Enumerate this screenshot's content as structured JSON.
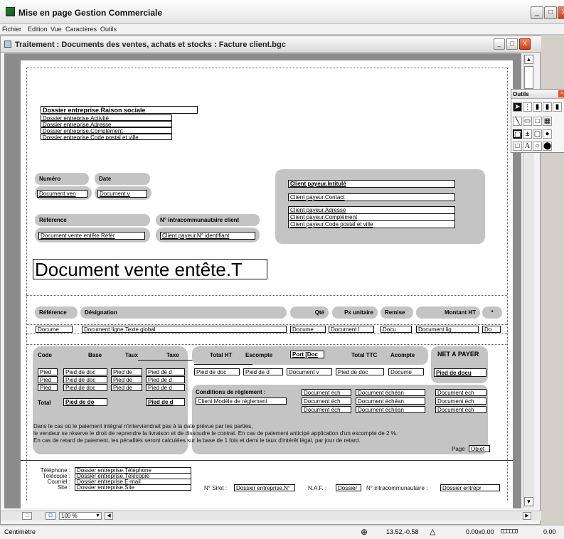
{
  "app": {
    "title": "Mise en page Gestion Commerciale"
  },
  "menu": [
    "Fichier",
    "Edition",
    "Vue",
    "Caractères",
    "Outils"
  ],
  "doc_window": {
    "title": "Traitement : Documents des ventes, achats et stocks : Facture client.bgc"
  },
  "company": {
    "raison": "Dossier entreprise.Raison sociale",
    "activite": "Dossier entreprise.Activité",
    "adresse": "Dossier entreprise.Adresse",
    "complement": "Dossier entreprise.Complément",
    "cp_ville": "Dossier entreprise.Code postal et ville"
  },
  "header": {
    "numero_label": "Numéro",
    "date_label": "Date",
    "numero_field": "Document ven",
    "date_field": "Document v",
    "reference_label": "Référence",
    "intracom_label": "N° intracommunautaire client",
    "reference_field": "Document vente entête.Référ",
    "intracom_field": "Client payeur.N° identifiant"
  },
  "client": {
    "intitule": "Client payeur.Intitulé",
    "contact": "Client payeur.Contact",
    "adresse": "Client payeur.Adresse",
    "complement": "Client payeur.Complément",
    "cp_ville": "Client payeur.Code postal et ville"
  },
  "big_title": "Document vente entête.T",
  "lines_header": {
    "reference": "Référence",
    "designation": "Désignation",
    "qte": "Qté",
    "pu": "Px unitaire",
    "remise": "Remise",
    "montant": "Montant HT",
    "star": "*"
  },
  "lines_row": [
    "Docume",
    "Document ligne.Texte global",
    "Docume",
    "Document l",
    "Docu",
    "Document lig",
    "Do"
  ],
  "totals_header": {
    "code": "Code",
    "base": "Base",
    "taux": "Taux",
    "taxe": "Taxe",
    "total_ht": "Total HT",
    "escompte": "Escompte",
    "port": "Port [Doc",
    "total_ttc": "Total TTC",
    "acompte": "Acompte",
    "net": "NET A PAYER"
  },
  "tax_rows": [
    [
      "Pied",
      "Pied de doc",
      "Pied de",
      "Pied de d"
    ],
    [
      "Pied",
      "Pied de doc",
      "Pied de",
      "Pied de d"
    ],
    [
      "Pied",
      "Pied de doc",
      "Pied de",
      "Pied de d"
    ]
  ],
  "totals_row": [
    "Pied de doc",
    "Pied de d",
    "Document v",
    "Pied de doc",
    "Docume",
    "Pied de docu"
  ],
  "total_label": "Total",
  "total_base": "Pied de do",
  "total_taxe": "Pied de d",
  "reglement": {
    "label": "Conditions de règlement :",
    "modele": "Client.Modèle de règlement",
    "ech_a": "Document éch",
    "ech_b": "Document échéan",
    "ech_c": "Document éch"
  },
  "legal": [
    "Dans le cas où le paiement intégral n'interviendrait pas à la date prévue par les parties,",
    "le vendeur se réserve le droit de reprendre la livraison et de dissoudre le contrat. En cas de paiement anticipé application d'un escompte de 2 %.",
    "En cas de retard de paiement, les pénalités seront calculées sur la base de 1 fois et demi le taux d'intérêt légal, par jour de retard."
  ],
  "page_label": "Page",
  "page_field": "Objet",
  "footer": {
    "tel_label": "Téléphone :",
    "fax_label": "Télécopie :",
    "mail_label": "Courriel :",
    "site_label": "Site :",
    "tel": "Dossier entreprise.Téléphone",
    "fax": "Dossier entreprise.Télécopie",
    "mail": "Dossier entreprise.E-mail",
    "site": "Dossier entreprise.Site",
    "siret_label": "N° Siret :",
    "siret": "Dossier entreprise.N°",
    "naf_label": "N.A.F. :",
    "naf": "Dossier",
    "intra_label": "N° intracommunautaire :",
    "intra": "Dossier entrepr"
  },
  "tools_panel": {
    "title": "Outils"
  },
  "zoom": "100 %",
  "status": {
    "unit": "Centimètre",
    "coords": "13.52,-0.58",
    "size": "0.00x0.00",
    "angle": "0.00"
  }
}
